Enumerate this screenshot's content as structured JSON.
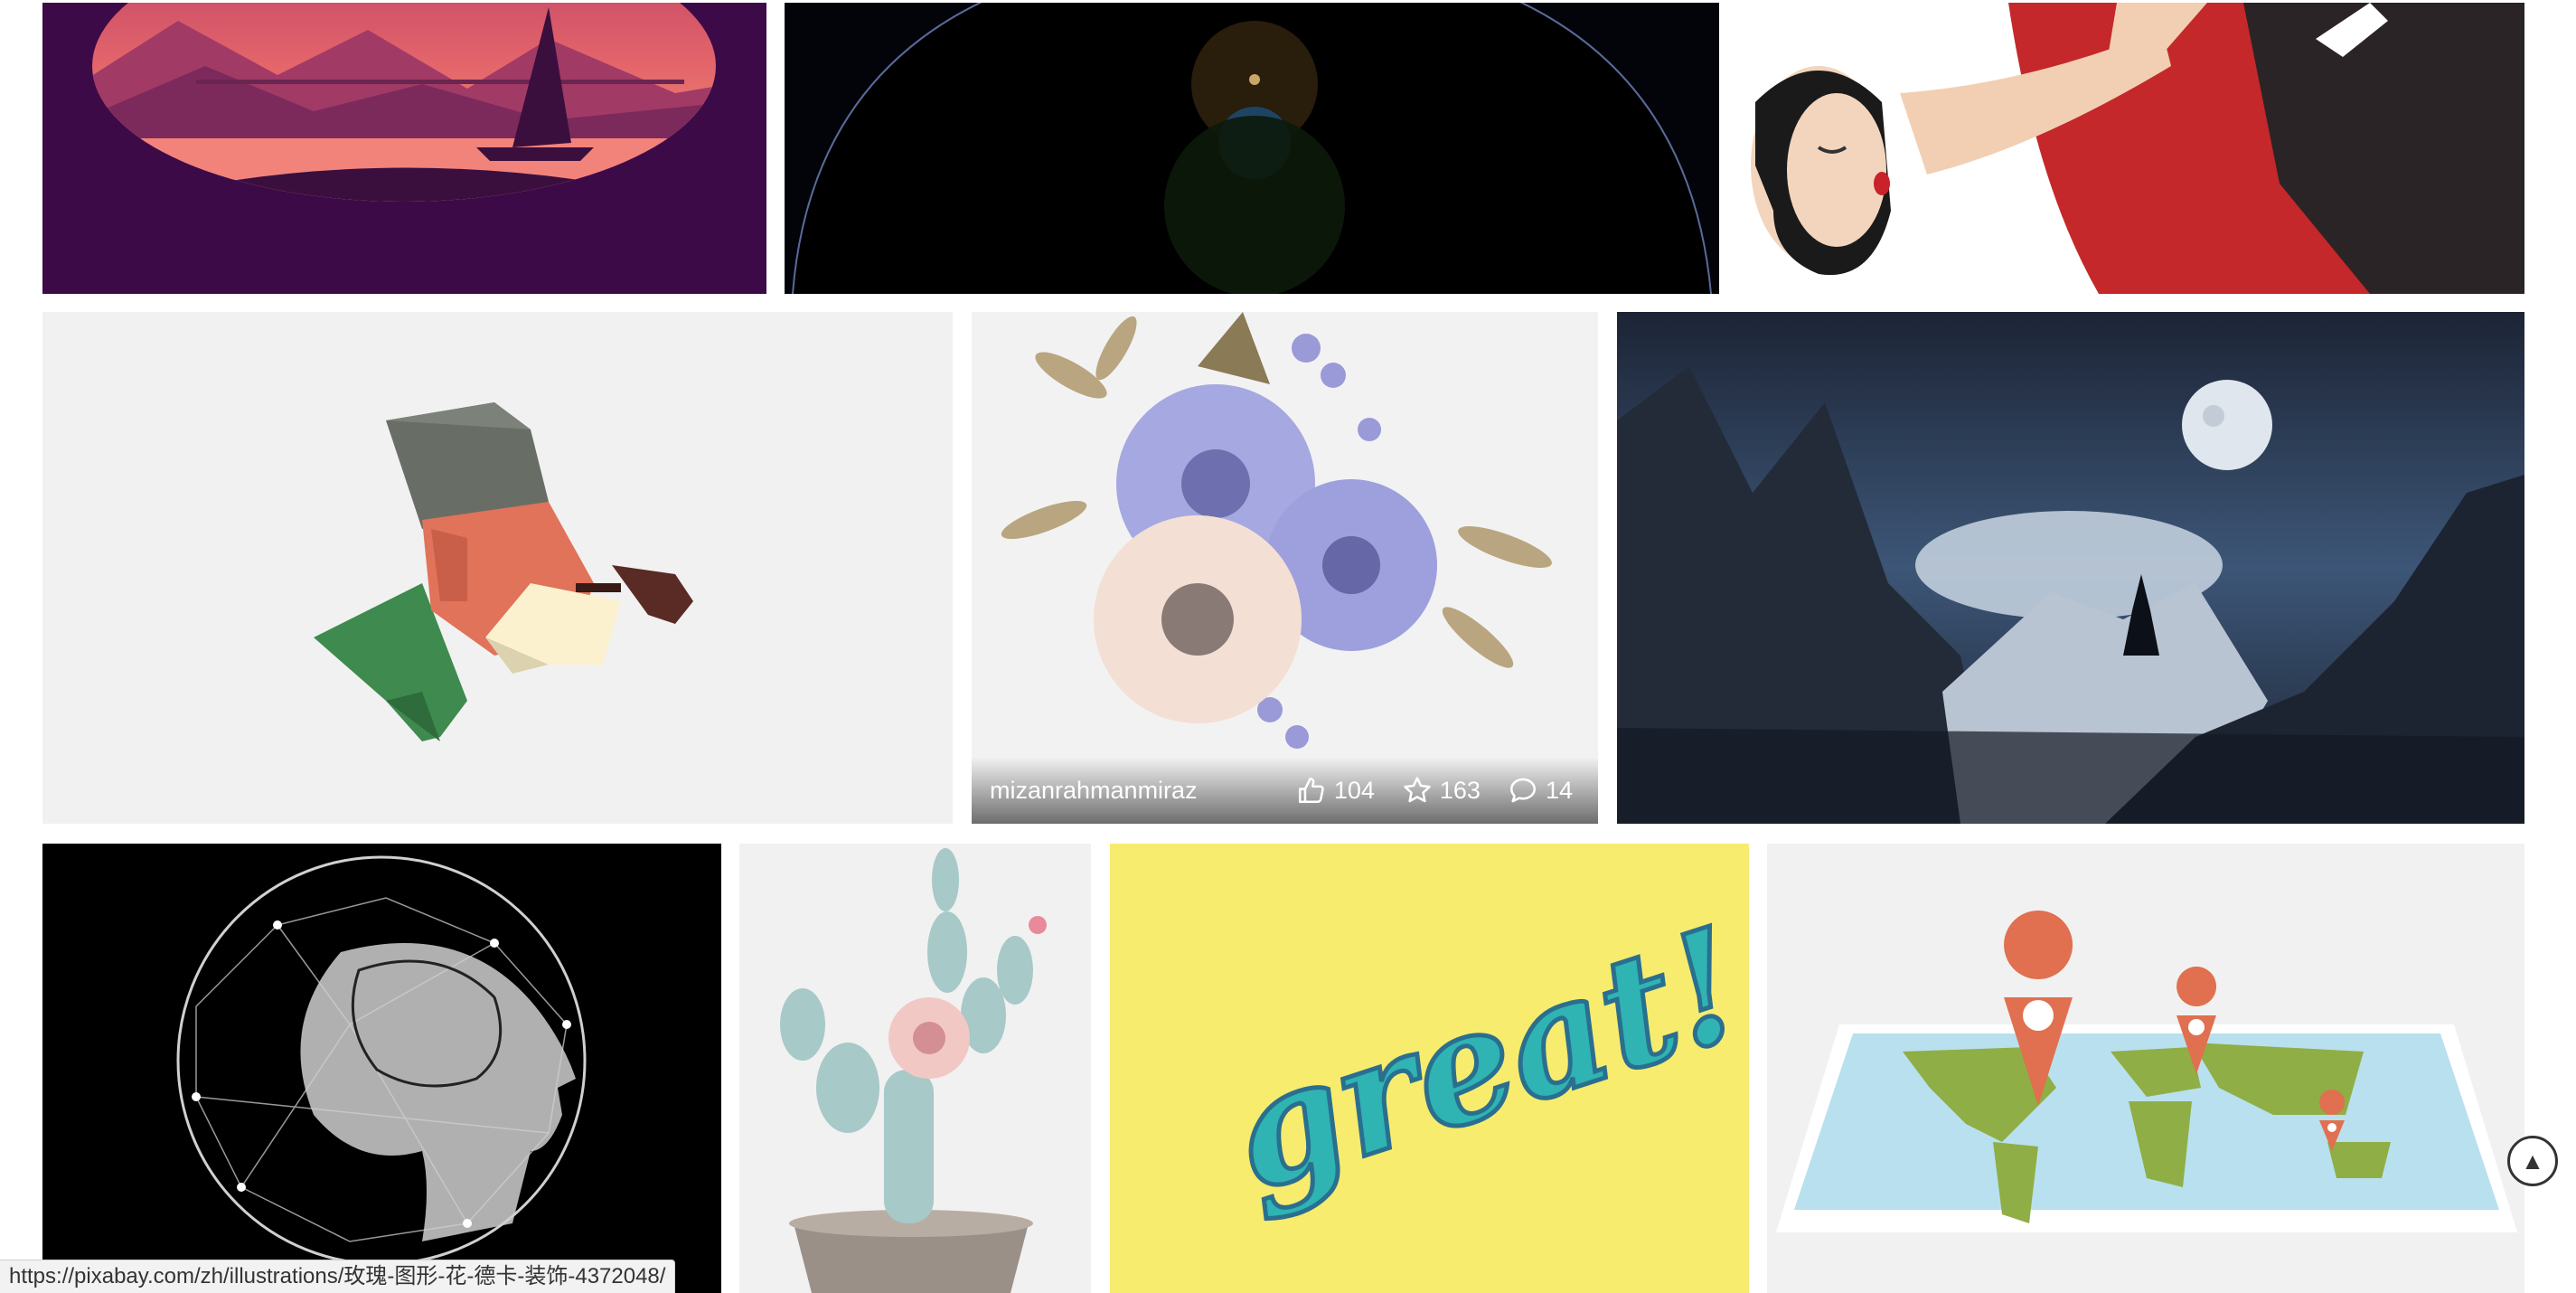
{
  "gallery": {
    "tiles": [
      {
        "id": "sunset-sailboat",
        "subject": "sunset-lake-sailboat"
      },
      {
        "id": "space-planet",
        "subject": "planet-horizon-lens-flare"
      },
      {
        "id": "woman-red-dress",
        "subject": "woman-red-dress-illustration"
      },
      {
        "id": "old-sailor",
        "subject": "low-poly-sailor-with-pipe"
      },
      {
        "id": "flower-bouquet",
        "subject": "watercolor-flower-bouquet",
        "hover": {
          "author": "mizanrahmanmiraz",
          "likes": "104",
          "favorites": "163",
          "comments": "14"
        }
      },
      {
        "id": "mountain-moon",
        "subject": "mountains-moon-night"
      },
      {
        "id": "brain-network",
        "subject": "head-brain-network"
      },
      {
        "id": "cactus-flower",
        "subject": "cactus-with-flower"
      },
      {
        "id": "great-lettering",
        "subject": "great-lettering",
        "text": "great!"
      },
      {
        "id": "world-map-pins",
        "subject": "world-map-location-pins"
      }
    ]
  },
  "status_bar": {
    "url": "https://pixabay.com/zh/illustrations/玫瑰-图形-花-德卡-装饰-4372048/"
  },
  "icons": {
    "likes": "thumbs-up-icon",
    "favorites": "star-icon",
    "comments": "comment-icon",
    "scroll_top": "arrow-up-icon"
  },
  "scroll_top_glyph": "▲",
  "colors": {
    "page_bg": "#ffffff",
    "great_bg": "#f7ec6e",
    "map_water": "#b9e0ef",
    "map_land": "#8fae45",
    "pin": "#e0704f"
  }
}
